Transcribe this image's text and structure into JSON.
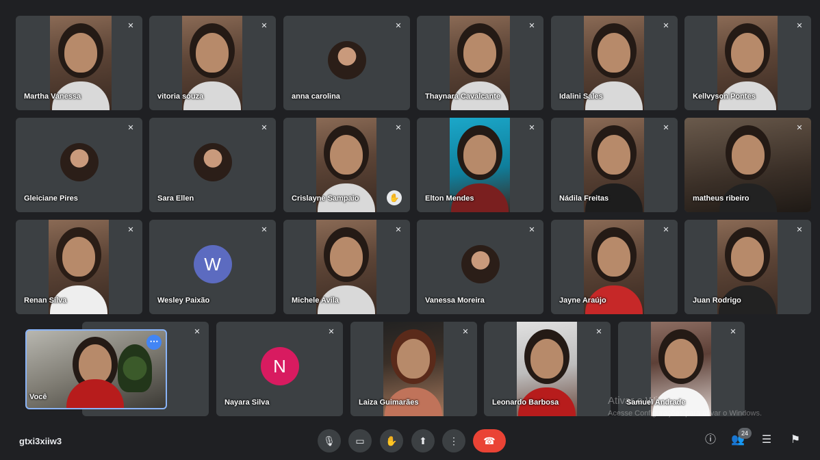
{
  "participants": [
    {
      "name": "Martha Vanessa"
    },
    {
      "name": "vitoria souza"
    },
    {
      "name": "anna carolina"
    },
    {
      "name": "Thaynara Cavalcante"
    },
    {
      "name": "Idalini Sales"
    },
    {
      "name": "Kellvyson Pontes"
    },
    {
      "name": "Gleiciane Pires"
    },
    {
      "name": "Sara Ellen"
    },
    {
      "name": "Crislayne Sampaio"
    },
    {
      "name": "Elton Mendes"
    },
    {
      "name": "Nádila Freitas"
    },
    {
      "name": "matheus ribeiro"
    },
    {
      "name": "Renan Silva"
    },
    {
      "name": "Wesley Paixão",
      "initial": "W",
      "avatar_color": "#5c6bc0"
    },
    {
      "name": "Michele Avila"
    },
    {
      "name": "Vanessa Moreira"
    },
    {
      "name": "Jayne Araújo"
    },
    {
      "name": "Juan Rodrigo"
    },
    {
      "name": "Nayara Silva",
      "initial": "N",
      "avatar_color": "#d81b60"
    },
    {
      "name": "Laiza Guimarães"
    },
    {
      "name": "Leonardo Barbosa"
    },
    {
      "name": "Samuel Andrade"
    }
  ],
  "self_view": {
    "name": "Você"
  },
  "watermark": {
    "title": "Ativar o Windows",
    "subtitle": "Acesse Configurações para ativar o Windows."
  },
  "meeting_code": "gtxi3xiiw3",
  "participant_count": "24",
  "icons": {
    "mic": "mic-icon",
    "camera": "camera-icon",
    "hand": "raise-hand-icon",
    "present": "present-screen-icon",
    "more": "more-options-icon",
    "end": "end-call-icon",
    "info": "info-icon",
    "people": "people-icon",
    "chat": "chat-icon",
    "activities": "activities-icon"
  },
  "colors": {
    "background": "#1f2023",
    "tile": "#3c4043",
    "end_call": "#ea4335",
    "self_border": "#8ab4f8"
  }
}
